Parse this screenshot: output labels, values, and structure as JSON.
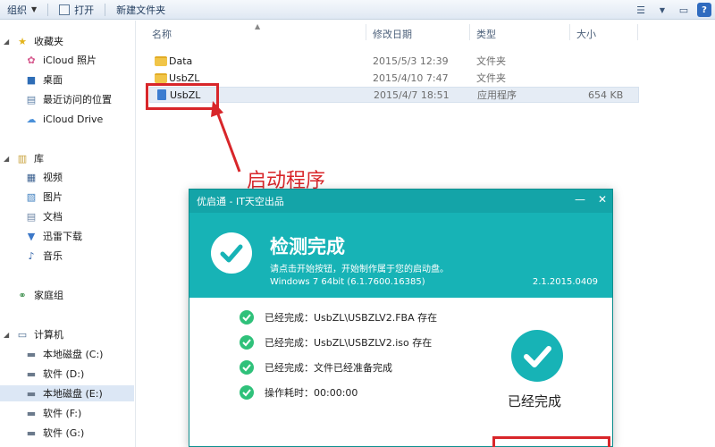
{
  "toolbar": {
    "organize": "组织",
    "open": "打开",
    "new_folder": "新建文件夹"
  },
  "nav": {
    "favorites": "收藏夹",
    "icloud_photos": "iCloud 照片",
    "desktop": "桌面",
    "recent": "最近访问的位置",
    "icloud_drive": "iCloud Drive",
    "libraries": "库",
    "videos": "视频",
    "pictures": "图片",
    "documents": "文档",
    "thunder": "迅雷下载",
    "music": "音乐",
    "homegroup": "家庭组",
    "computer": "计算机",
    "drive_c": "本地磁盘 (C:)",
    "drive_d": "软件 (D:)",
    "drive_e": "本地磁盘 (E:)",
    "drive_f": "软件 (F:)",
    "drive_g": "软件 (G:)"
  },
  "columns": {
    "name": "名称",
    "date": "修改日期",
    "type": "类型",
    "size": "大小"
  },
  "files": [
    {
      "name": "Data",
      "date": "2015/5/3 12:39",
      "type": "文件夹",
      "size": ""
    },
    {
      "name": "UsbZL",
      "date": "2015/4/10 7:47",
      "type": "文件夹",
      "size": ""
    },
    {
      "name": "UsbZL",
      "date": "2015/4/7 18:51",
      "type": "应用程序",
      "size": "654 KB"
    }
  ],
  "annotation": "启动程序",
  "dialog": {
    "title": "优启通 - IT天空出品",
    "heading": "检测完成",
    "subtitle": "请点击开始按钮，开始制作属于您的启动盘。",
    "os": "Windows 7 64bit (6.1.7600.16385)",
    "version": "2.1.2015.0409",
    "status": [
      "已经完成：UsbZL\\USBZLV2.FBA 存在",
      "已经完成：UsbZL\\USBZLV2.iso 存在",
      "已经完成：文件已经准备完成",
      "操作耗时：00:00:00"
    ],
    "done": "已经完成"
  },
  "colors": {
    "accent": "#17b3b6",
    "highlight": "#d8262a",
    "check_green": "#2fc17a"
  }
}
